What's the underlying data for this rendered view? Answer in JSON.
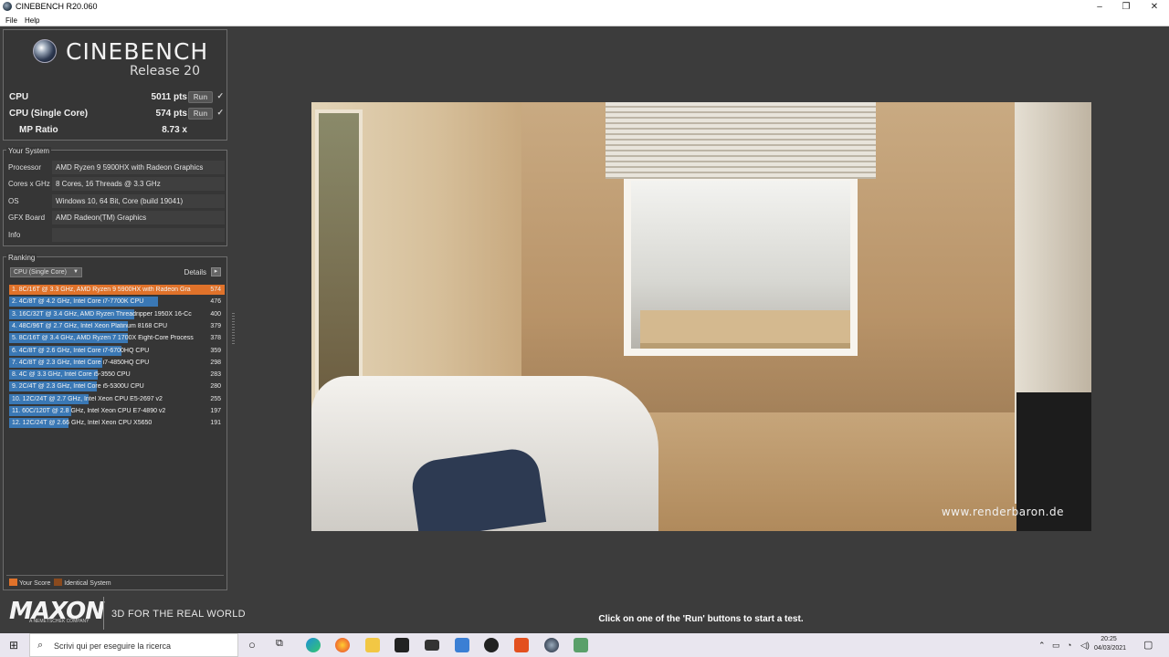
{
  "window": {
    "title": "CINEBENCH R20.060",
    "minimize": "–",
    "maximize": "❐",
    "close": "✕"
  },
  "menu": [
    "File",
    "Help"
  ],
  "logo": {
    "name": "CINEBENCH",
    "release": "Release 20"
  },
  "scores": [
    {
      "label": "CPU",
      "value": "5011 pts",
      "run": "Run",
      "check": "✓"
    },
    {
      "label": "CPU (Single Core)",
      "value": "574 pts",
      "run": "Run",
      "check": "✓"
    },
    {
      "label": "MP Ratio",
      "value": "8.73 x"
    }
  ],
  "system": {
    "title": "Your System",
    "rows": [
      {
        "key": "Processor",
        "value": "AMD Ryzen 9 5900HX with Radeon Graphics"
      },
      {
        "key": "Cores x GHz",
        "value": "8 Cores, 16 Threads @ 3.3 GHz"
      },
      {
        "key": "OS",
        "value": "Windows 10, 64 Bit, Core (build 19041)"
      },
      {
        "key": "GFX Board",
        "value": "AMD Radeon(TM) Graphics"
      },
      {
        "key": "Info",
        "value": ""
      }
    ]
  },
  "ranking": {
    "title": "Ranking",
    "selected": "CPU (Single Core)",
    "details_label": "Details",
    "details_btn": "▸",
    "max": 574,
    "rows": [
      {
        "text": "1. 8C/16T @ 3.3 GHz, AMD Ryzen 9 5900HX with Radeon Gra",
        "score": 574,
        "mine": true
      },
      {
        "text": "2. 4C/8T @ 4.2 GHz, Intel Core i7-7700K CPU",
        "score": 476
      },
      {
        "text": "3. 16C/32T @ 3.4 GHz, AMD Ryzen Threadripper 1950X 16-Cc",
        "score": 400
      },
      {
        "text": "4. 48C/96T @ 2.7 GHz, Intel Xeon Platinum 8168 CPU",
        "score": 379
      },
      {
        "text": "5. 8C/16T @ 3.4 GHz, AMD Ryzen 7 1700X Eight-Core Process",
        "score": 378
      },
      {
        "text": "6. 4C/8T @ 2.6 GHz, Intel Core i7-6700HQ CPU",
        "score": 359
      },
      {
        "text": "7. 4C/8T @ 2.3 GHz, Intel Core i7-4850HQ CPU",
        "score": 298
      },
      {
        "text": "8. 4C @ 3.3 GHz, Intel Core i5-3550 CPU",
        "score": 283
      },
      {
        "text": "9. 2C/4T @ 2.3 GHz, Intel Core i5-5300U CPU",
        "score": 280
      },
      {
        "text": "10. 12C/24T @ 2.7 GHz, Intel Xeon CPU E5-2697 v2",
        "score": 255
      },
      {
        "text": "11. 60C/120T @ 2.8 GHz, Intel Xeon CPU E7-4890 v2",
        "score": 197
      },
      {
        "text": "12. 12C/24T @ 2.66 GHz, Intel Xeon CPU X5650",
        "score": 191
      }
    ],
    "legend": {
      "your_score": "Your Score",
      "identical": "Identical System"
    }
  },
  "colors": {
    "your_score": "#e0722a",
    "identical": "#8a4a1e",
    "bar": "#3a78b5"
  },
  "branding": {
    "maxon": "MAXON",
    "maxon_sub": "A NEMETSCHEK COMPANY",
    "tagline": "3D FOR THE REAL WORLD"
  },
  "render": {
    "watermark": "www.renderbaron.de"
  },
  "hint": "Click on one of the 'Run' buttons to start a test.",
  "taskbar": {
    "search_placeholder": "Scrivi qui per eseguire la ricerca",
    "time": "20:25",
    "date": "04/03/2021",
    "icons": [
      "cortana-icon",
      "task-view-icon",
      "edge-icon",
      "firefox-icon",
      "file-explorer-icon",
      "store-icon",
      "mail-icon",
      "vscode-icon",
      "xbox-icon",
      "office-icon",
      "cinebench-icon",
      "snipping-icon"
    ]
  }
}
